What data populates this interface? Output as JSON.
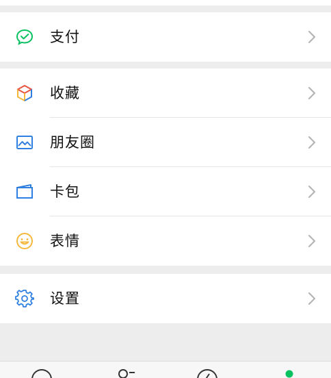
{
  "menu": {
    "pay": {
      "label": "支付",
      "icon": "wechat-pay-icon"
    },
    "favorites": {
      "label": "收藏",
      "icon": "favorites-cube-icon"
    },
    "moments": {
      "label": "朋友圈",
      "icon": "moments-photo-icon"
    },
    "cards": {
      "label": "卡包",
      "icon": "card-wallet-icon"
    },
    "stickers": {
      "label": "表情",
      "icon": "sticker-smiley-icon"
    },
    "settings": {
      "label": "设置",
      "icon": "gear-icon"
    }
  },
  "tabbar": {
    "tabs": [
      {
        "icon": "chats-icon"
      },
      {
        "icon": "contacts-icon"
      },
      {
        "icon": "discover-icon"
      },
      {
        "icon": "me-icon"
      }
    ]
  },
  "colors": {
    "wechat_green": "#07c160",
    "blue_icon": "#2f7fe0",
    "sticker_yellow": "#f6b83c",
    "chevron_gray": "#b2b2b2"
  }
}
